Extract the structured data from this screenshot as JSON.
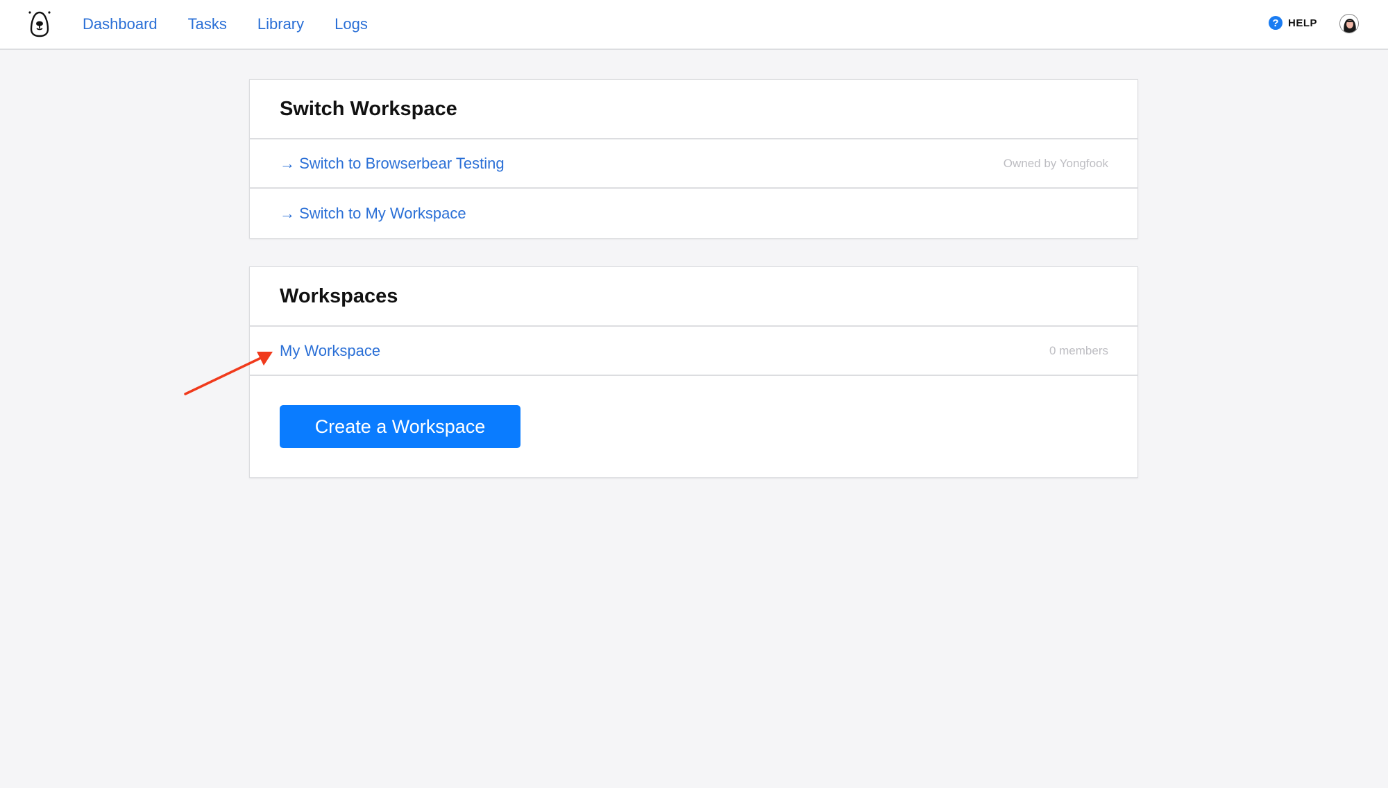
{
  "nav": {
    "items": [
      {
        "label": "Dashboard"
      },
      {
        "label": "Tasks"
      },
      {
        "label": "Library"
      },
      {
        "label": "Logs"
      }
    ],
    "help_label": "HELP",
    "help_icon": "?"
  },
  "switch_card": {
    "title": "Switch Workspace",
    "rows": [
      {
        "label": "→ Switch to Browserbear Testing",
        "meta": "Owned by Yongfook"
      },
      {
        "label": "→ Switch to My Workspace",
        "meta": ""
      }
    ]
  },
  "workspaces_card": {
    "title": "Workspaces",
    "rows": [
      {
        "label": "My Workspace",
        "meta": "0 members"
      }
    ],
    "create_button": "Create a Workspace"
  },
  "colors": {
    "link": "#2a6fd6",
    "primary_button": "#0a7cff",
    "annotation_arrow": "#f03a1c",
    "background": "#f5f5f7"
  }
}
